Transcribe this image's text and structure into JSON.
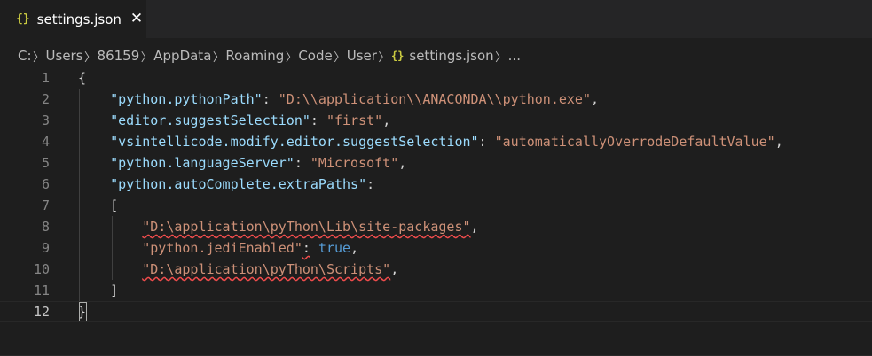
{
  "tab": {
    "icon_glyph": "{}",
    "label": "settings.json",
    "close_glyph": "✕"
  },
  "breadcrumb": {
    "items": [
      "C:",
      "Users",
      "86159",
      "AppData",
      "Roaming",
      "Code",
      "User"
    ],
    "file_icon_glyph": "{}",
    "file": "settings.json",
    "more": "...",
    "separator": "〉"
  },
  "editor": {
    "lines": [
      {
        "n": "1",
        "tokens": [
          {
            "t": "{",
            "c": "p"
          }
        ]
      },
      {
        "n": "2",
        "tokens": [
          {
            "t": "    ",
            "c": "p"
          },
          {
            "t": "\"python.pythonPath\"",
            "c": "k"
          },
          {
            "t": ": ",
            "c": "p"
          },
          {
            "t": "\"D:\\\\application\\\\ANACONDA\\\\python.exe\"",
            "c": "s"
          },
          {
            "t": ",",
            "c": "p"
          }
        ]
      },
      {
        "n": "3",
        "tokens": [
          {
            "t": "    ",
            "c": "p"
          },
          {
            "t": "\"editor.suggestSelection\"",
            "c": "k"
          },
          {
            "t": ": ",
            "c": "p"
          },
          {
            "t": "\"first\"",
            "c": "s"
          },
          {
            "t": ",",
            "c": "p"
          }
        ]
      },
      {
        "n": "4",
        "tokens": [
          {
            "t": "    ",
            "c": "p"
          },
          {
            "t": "\"vsintellicode.modify.editor.suggestSelection\"",
            "c": "k"
          },
          {
            "t": ": ",
            "c": "p"
          },
          {
            "t": "\"automaticallyOverrodeDefaultValue\"",
            "c": "s"
          },
          {
            "t": ",",
            "c": "p"
          }
        ]
      },
      {
        "n": "5",
        "tokens": [
          {
            "t": "    ",
            "c": "p"
          },
          {
            "t": "\"python.languageServer\"",
            "c": "k"
          },
          {
            "t": ": ",
            "c": "p"
          },
          {
            "t": "\"Microsoft\"",
            "c": "s"
          },
          {
            "t": ",",
            "c": "p"
          }
        ]
      },
      {
        "n": "6",
        "tokens": [
          {
            "t": "    ",
            "c": "p"
          },
          {
            "t": "\"python.autoComplete.extraPaths\"",
            "c": "k"
          },
          {
            "t": ":",
            "c": "p"
          }
        ]
      },
      {
        "n": "7",
        "tokens": [
          {
            "t": "    ",
            "c": "p"
          },
          {
            "t": "[",
            "c": "p"
          }
        ]
      },
      {
        "n": "8",
        "tokens": [
          {
            "t": "        ",
            "c": "p"
          },
          {
            "t": "\"D:\\application\\pyThon\\Lib\\site-packages\"",
            "c": "s",
            "sq": true
          },
          {
            "t": ",",
            "c": "p"
          }
        ]
      },
      {
        "n": "9",
        "tokens": [
          {
            "t": "        ",
            "c": "p"
          },
          {
            "t": "\"python.jediEnabled\"",
            "c": "s"
          },
          {
            "t": ":",
            "c": "p",
            "sq": true
          },
          {
            "t": " ",
            "c": "p"
          },
          {
            "t": "true",
            "c": "b"
          },
          {
            "t": ",",
            "c": "p"
          }
        ]
      },
      {
        "n": "10",
        "tokens": [
          {
            "t": "        ",
            "c": "p"
          },
          {
            "t": "\"D:\\application\\pyThon\\Scripts\"",
            "c": "s",
            "sq": true
          },
          {
            "t": ",",
            "c": "p"
          }
        ]
      },
      {
        "n": "11",
        "tokens": [
          {
            "t": "    ",
            "c": "p"
          },
          {
            "t": "]",
            "c": "p"
          }
        ]
      },
      {
        "n": "12",
        "tokens": [
          {
            "t": "}",
            "c": "p"
          }
        ]
      }
    ],
    "current_line": 12
  },
  "colors": {
    "background": "#1e1e1e",
    "tabbar": "#252526",
    "key": "#9cdcfe",
    "string": "#ce9178",
    "boolean": "#569cd6",
    "json_icon": "#cbcb41",
    "squiggle": "#f14c4c"
  }
}
